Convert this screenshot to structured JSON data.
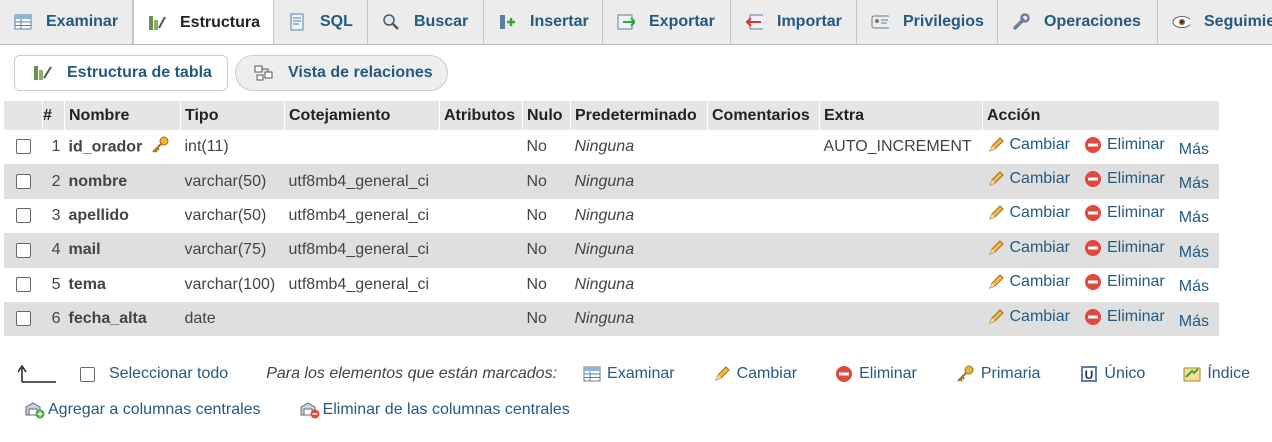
{
  "tabs": [
    {
      "label": "Examinar",
      "icon": "table-browse-icon",
      "active": false
    },
    {
      "label": "Estructura",
      "icon": "structure-icon",
      "active": true
    },
    {
      "label": "SQL",
      "icon": "sql-icon",
      "active": false
    },
    {
      "label": "Buscar",
      "icon": "search-icon",
      "active": false
    },
    {
      "label": "Insertar",
      "icon": "insert-icon",
      "active": false
    },
    {
      "label": "Exportar",
      "icon": "export-icon",
      "active": false
    },
    {
      "label": "Importar",
      "icon": "import-icon",
      "active": false
    },
    {
      "label": "Privilegios",
      "icon": "privileges-icon",
      "active": false
    },
    {
      "label": "Operaciones",
      "icon": "wrench-icon",
      "active": false
    },
    {
      "label": "Seguimiento",
      "icon": "eye-icon",
      "active": false
    }
  ],
  "subnav": {
    "table_structure": "Estructura de tabla",
    "relation_view": "Vista de relaciones"
  },
  "table": {
    "headers": [
      "#",
      "Nombre",
      "Tipo",
      "Cotejamiento",
      "Atributos",
      "Nulo",
      "Predeterminado",
      "Comentarios",
      "Extra",
      "Acción"
    ],
    "rows": [
      {
        "num": "1",
        "name": "id_orador",
        "type": "int(11)",
        "collation": "",
        "attributes": "",
        "null": "No",
        "default": "Ninguna",
        "comments": "",
        "extra": "AUTO_INCREMENT",
        "primary_key": true
      },
      {
        "num": "2",
        "name": "nombre",
        "type": "varchar(50)",
        "collation": "utf8mb4_general_ci",
        "attributes": "",
        "null": "No",
        "default": "Ninguna",
        "comments": "",
        "extra": "",
        "primary_key": false
      },
      {
        "num": "3",
        "name": "apellido",
        "type": "varchar(50)",
        "collation": "utf8mb4_general_ci",
        "attributes": "",
        "null": "No",
        "default": "Ninguna",
        "comments": "",
        "extra": "",
        "primary_key": false
      },
      {
        "num": "4",
        "name": "mail",
        "type": "varchar(75)",
        "collation": "utf8mb4_general_ci",
        "attributes": "",
        "null": "No",
        "default": "Ninguna",
        "comments": "",
        "extra": "",
        "primary_key": false
      },
      {
        "num": "5",
        "name": "tema",
        "type": "varchar(100)",
        "collation": "utf8mb4_general_ci",
        "attributes": "",
        "null": "No",
        "default": "Ninguna",
        "comments": "",
        "extra": "",
        "primary_key": false
      },
      {
        "num": "6",
        "name": "fecha_alta",
        "type": "date",
        "collation": "",
        "attributes": "",
        "null": "No",
        "default": "Ninguna",
        "comments": "",
        "extra": "",
        "primary_key": false
      }
    ],
    "actions": {
      "change": "Cambiar",
      "drop": "Eliminar",
      "more": "Más"
    }
  },
  "bulk": {
    "select_all": "Seleccionar todo",
    "with_selected": "Para los elementos que están marcados:",
    "browse": "Examinar",
    "change": "Cambiar",
    "drop": "Eliminar",
    "primary": "Primaria",
    "unique": "Único",
    "index": "Índice",
    "add_central": "Agregar a columnas centrales",
    "remove_central": "Eliminar de las columnas centrales"
  },
  "colors": {
    "link": "#235a81",
    "header_bg": "#e5e5e5",
    "row_alt": "#dfdfdf",
    "drop_red": "#e2483c",
    "pencil": "#e8a317"
  }
}
